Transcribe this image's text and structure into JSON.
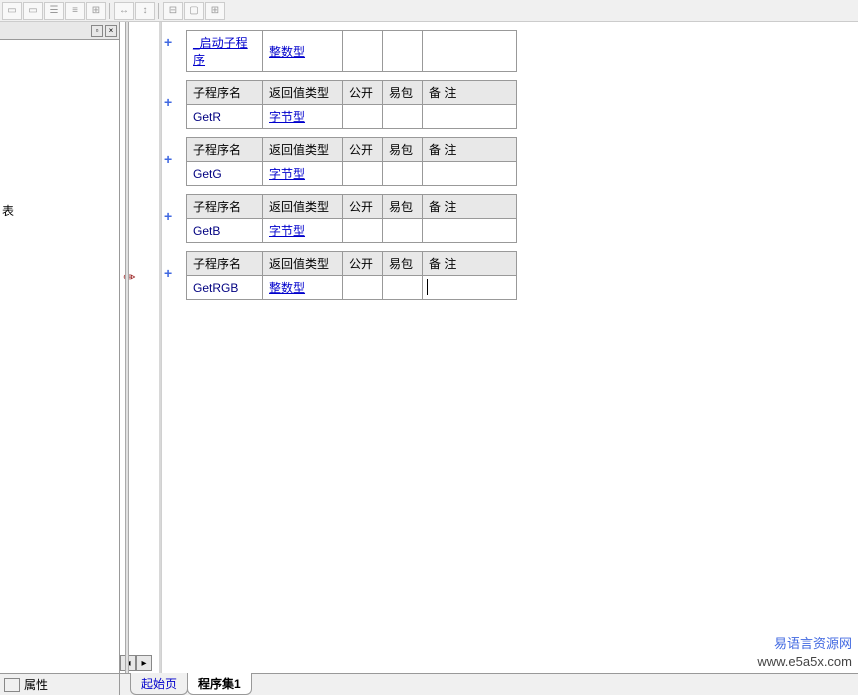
{
  "left_panel": {
    "biao": "表"
  },
  "table0": {
    "name": "_启动子程序",
    "type": "整数型"
  },
  "headers": {
    "name": "子程序名",
    "type": "返回值类型",
    "pub": "公开",
    "pkg": "易包",
    "note": "备 注"
  },
  "subs": [
    {
      "name": "GetR",
      "type": "字节型"
    },
    {
      "name": "GetG",
      "type": "字节型"
    },
    {
      "name": "GetB",
      "type": "字节型"
    },
    {
      "name": "GetRGB",
      "type": "整数型"
    }
  ],
  "bottom": {
    "prop": "属性",
    "tab_start": "起始页",
    "tab_prog": "程序集1"
  },
  "watermark": {
    "cn": "易语言资源网",
    "url": "www.e5a5x.com"
  }
}
